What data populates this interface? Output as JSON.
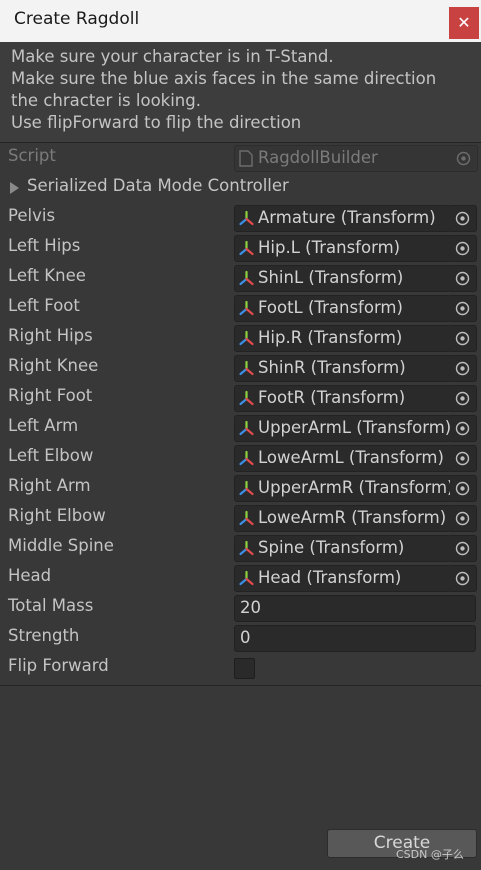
{
  "window": {
    "title": "Create Ragdoll",
    "close_glyph": "✕"
  },
  "help_lines": [
    "Make sure your character is in T-Stand.",
    "Make sure the blue axis faces in the same direction",
    "the chracter is looking.",
    "Use flipForward to flip the direction"
  ],
  "script": {
    "label": "Script",
    "value": "RagdollBuilder"
  },
  "foldout": {
    "label": "Serialized Data Mode Controller"
  },
  "bones": [
    {
      "label": "Pelvis",
      "value": "Armature (Transform)"
    },
    {
      "label": "Left Hips",
      "value": "Hip.L (Transform)"
    },
    {
      "label": "Left Knee",
      "value": "ShinL (Transform)"
    },
    {
      "label": "Left Foot",
      "value": "FootL (Transform)"
    },
    {
      "label": "Right Hips",
      "value": "Hip.R (Transform)"
    },
    {
      "label": "Right Knee",
      "value": "ShinR (Transform)"
    },
    {
      "label": "Right Foot",
      "value": "FootR (Transform)"
    },
    {
      "label": "Left Arm",
      "value": "UpperArmL (Transform)"
    },
    {
      "label": "Left Elbow",
      "value": "LoweArmL (Transform)"
    },
    {
      "label": "Right Arm",
      "value": "UpperArmR (Transform)"
    },
    {
      "label": "Right Elbow",
      "value": "LoweArmR (Transform)"
    },
    {
      "label": "Middle Spine",
      "value": "Spine (Transform)"
    },
    {
      "label": "Head",
      "value": "Head (Transform)"
    }
  ],
  "total_mass": {
    "label": "Total Mass",
    "value": "20"
  },
  "strength": {
    "label": "Strength",
    "value": "0"
  },
  "flip_forward": {
    "label": "Flip Forward",
    "checked": false
  },
  "create_button": {
    "label": "Create"
  },
  "watermark": "CSDN @子么",
  "icons": {
    "transform": "transform-axis-icon",
    "picker": "object-picker-icon",
    "script": "script-file-icon"
  },
  "colors": {
    "axis_x": "#e24b4b",
    "axis_y": "#8ed13f",
    "axis_z": "#3d8fe6",
    "close": "#c94242"
  }
}
